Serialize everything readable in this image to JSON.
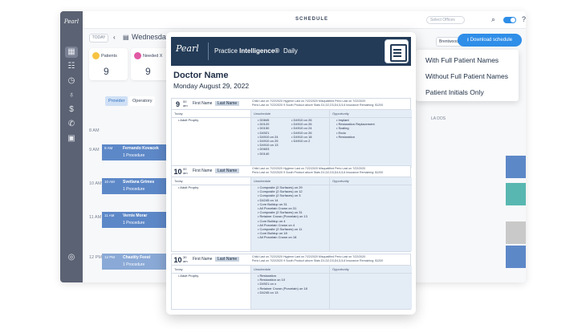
{
  "app": {
    "logo_text": "Pearl",
    "title": "SCHEDULE",
    "select_placeholder": "Select Offices",
    "date": {
      "today_label": "TODAY",
      "prev": "‹",
      "current": "Wednesday"
    },
    "stats": [
      {
        "label": "Patients",
        "value": "9",
        "color": "#f6c342"
      },
      {
        "label": "Needed X",
        "value": "9",
        "color": "#e05aa4"
      }
    ],
    "tabs": [
      {
        "label": "Provider",
        "active": true
      },
      {
        "label": "Operatory",
        "active": false
      }
    ],
    "times": [
      "8 AM",
      "9 AM",
      "10 AM",
      "11 AM",
      "12 PM"
    ],
    "appointments": [
      {
        "time": "9 AM",
        "name": "Fernando Kovacek",
        "procedure": "1 Procedure"
      },
      {
        "time": "10 AM",
        "name": "Svetlana Grimes",
        "procedure": "1 Procedure"
      },
      {
        "time": "11 AM",
        "name": "Vernie Morar",
        "procedure": "1 Procedure"
      },
      {
        "time": "12 PM",
        "name": "Chastity Feest",
        "procedure": "1 Procedure"
      }
    ],
    "dropdown_label": "Brentwood",
    "download_label": "Download schedule",
    "right_label": "LA DOS",
    "menu": [
      "With Full Patient Names",
      "Without Full Patient Names",
      "Patient Initials Only"
    ]
  },
  "report": {
    "logo_text": "Pearl",
    "brand_prefix": "Practice ",
    "brand_bold": "Intelligence®",
    "brand_suffix": "Daily",
    "doctor_name": "Doctor Name",
    "date": "Monday August 29, 2022",
    "cards": [
      {
        "hour": "9",
        "minutes": "00",
        "ampm": "am",
        "first_name": "First Name",
        "last_name": "Last Name",
        "meta_line1": "Child   Last on 7/22/2020   Hygiene   Last on 7/22/2020   Misquatified Perio   Last on 7/22/2020",
        "meta_line2": "Perio  Last on 7/22/2020  9 South Product above Stats D1,D2,D3,D4,5,5,6  Insurance Remaining: $1200",
        "today_label": "Today",
        "today_items": [
          "• Adult Prophy"
        ],
        "unschedule_label": "Unschedule",
        "unschedule_items": [
          [
            "• D0845",
            "• D4910 on 26"
          ],
          [
            "• D0120",
            "• D4910 on 26"
          ],
          [
            "• D0150",
            "• D4910 on 24"
          ],
          [
            "• D4921",
            "• D4910 on 26"
          ],
          [
            "• D4910 on 24",
            "• D4910 on 18"
          ],
          [
            "• D4910 on 25",
            "• D4910 on 2"
          ],
          [
            "• D4910 on 13",
            ""
          ],
          [
            "• D0603",
            ""
          ],
          [
            "• D0140",
            ""
          ]
        ],
        "opportunity_label": "Opportunity",
        "opportunity_items": [
          "• Implant",
          "• Restoration Replacement",
          "• Scaling",
          "• Endo",
          "• Restoration"
        ]
      },
      {
        "hour": "10",
        "minutes": "00",
        "ampm": "am",
        "first_name": "First Name",
        "last_name": "Last Name",
        "meta_line1": "Child   Last on 7/22/2020   Hygiene   Last on 7/22/2020   Misquatified Perio   Last on 7/22/2020",
        "meta_line2": "Perio  Last on 7/22/2020  9 South Product above Stats D1,D2,D3,D4,5,5,6  Insurance Remaining: $1200",
        "today_label": "Today",
        "today_items": [
          "• Adult Prophy"
        ],
        "unschedule_label": "Unschedule",
        "unschedule_items": [
          [
            "• Composite (2 Surfaces) on 29",
            ""
          ],
          [
            "• Composite (2 Surfaces) on 12",
            ""
          ],
          [
            "• Composite (2 Surfaces) on 3",
            ""
          ],
          [
            "• D4245 on 14",
            ""
          ],
          [
            "• Core Buildup on 31",
            ""
          ],
          [
            "• All Porcelain Crown on 31",
            ""
          ],
          [
            "• Composite (2 Surfaces) on 31",
            ""
          ],
          [
            "• Retainer Crown (Porcelain) on 13",
            ""
          ],
          [
            "• Core Buildup on 4",
            ""
          ],
          [
            "• All Porcelain Crown on 4",
            ""
          ],
          [
            "• Composite (2 Surfaces) on 11",
            ""
          ],
          [
            "• Core Buildup on 18",
            ""
          ],
          [
            "• All Porcelain Crown on 18",
            ""
          ]
        ],
        "opportunity_label": "Opportunity",
        "opportunity_items": []
      },
      {
        "hour": "10",
        "minutes": "30",
        "ampm": "am",
        "first_name": "First Name",
        "last_name": "Last Name",
        "meta_line1": "Child   Last on 7/22/2020   Hygiene   Last on 7/22/2020   Misquatified Perio   Last on 7/22/2020",
        "meta_line2": "Perio  Last on 7/22/2020  9 South Product above Stats D1,D2,D3,D4,5,5,6  Insurance Remaining: $1200",
        "today_label": "Today",
        "today_items": [
          "• Adult Prophy"
        ],
        "unschedule_label": "Unschedule",
        "unschedule_items": [
          [
            "• Restoration",
            ""
          ],
          [
            "• Restoration on 10",
            ""
          ],
          [
            "• D4921 on x",
            ""
          ],
          [
            "• Retainer Crown (Porcelain) on 18",
            ""
          ],
          [
            "• D4245 on 13",
            ""
          ]
        ],
        "opportunity_label": "Opportunity",
        "opportunity_items": []
      }
    ]
  }
}
